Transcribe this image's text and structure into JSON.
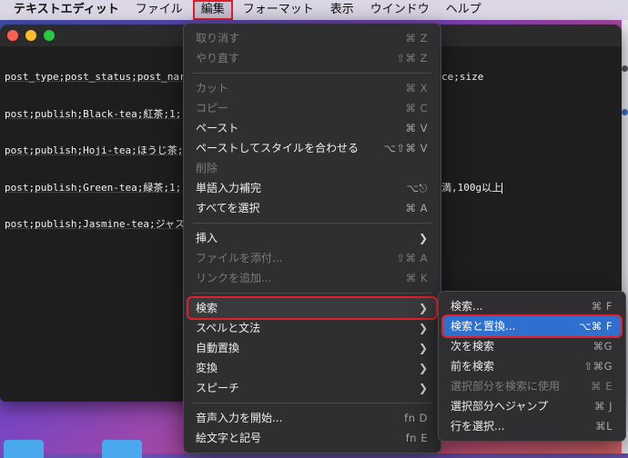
{
  "menubar": {
    "app": "テキストエディット",
    "items": [
      "ファイル",
      "編集",
      "フォーマット",
      "表示",
      "ウインドウ",
      "ヘルプ"
    ]
  },
  "document": {
    "lines": [
      "post_type;post_status;post_nar",
      "post;publish;Black-tea;紅茶;1;",
      "post;publish;Hoji-tea;ほうじ茶;",
      "post;publish;Green-tea;緑茶;1;",
      "post;publish;Jasmine-tea;ジャス"
    ],
    "right_lines": [
      "ce;size",
      "",
      "",
      "満,100g以上"
    ]
  },
  "edit_menu": {
    "items": [
      {
        "label": "取り消す",
        "shortcut": "⌘ Z",
        "disabled": true
      },
      {
        "label": "やり直す",
        "shortcut": "⇧⌘ Z",
        "disabled": true
      },
      {
        "sep": true
      },
      {
        "label": "カット",
        "shortcut": "⌘ X",
        "disabled": true
      },
      {
        "label": "コピー",
        "shortcut": "⌘ C",
        "disabled": true
      },
      {
        "label": "ペースト",
        "shortcut": "⌘ V"
      },
      {
        "label": "ペーストしてスタイルを合わせる",
        "shortcut": "⌥⇧⌘ V"
      },
      {
        "label": "削除",
        "shortcut": "",
        "disabled": true
      },
      {
        "label": "単語入力補完",
        "shortcut": "⌥⎋"
      },
      {
        "label": "すべてを選択",
        "shortcut": "⌘ A"
      },
      {
        "sep": true
      },
      {
        "label": "挿入",
        "submenu": true
      },
      {
        "label": "ファイルを添付...",
        "shortcut": "⇧⌘ A",
        "disabled": true
      },
      {
        "label": "リンクを追加...",
        "shortcut": "⌘ K",
        "disabled": true
      },
      {
        "sep": true
      },
      {
        "label": "検索",
        "submenu": true,
        "highlight": true
      },
      {
        "label": "スペルと文法",
        "submenu": true
      },
      {
        "label": "自動置換",
        "submenu": true
      },
      {
        "label": "変換",
        "submenu": true
      },
      {
        "label": "スピーチ",
        "submenu": true
      },
      {
        "sep": true
      },
      {
        "label": "音声入力を開始...",
        "shortcut": "fn D"
      },
      {
        "label": "絵文字と記号",
        "shortcut": "fn E"
      }
    ]
  },
  "find_menu": {
    "items": [
      {
        "label": "検索...",
        "shortcut": "⌘ F"
      },
      {
        "label": "検索と置換...",
        "shortcut": "⌥⌘ F",
        "selected": true
      },
      {
        "label": "次を検索",
        "shortcut": "⌘G"
      },
      {
        "label": "前を検索",
        "shortcut": "⇧⌘G"
      },
      {
        "label": "選択部分を検索に使用",
        "shortcut": "⌘ E",
        "disabled": true
      },
      {
        "label": "選択部分へジャンプ",
        "shortcut": "⌘ J"
      },
      {
        "label": "行を選択...",
        "shortcut": "⌘L"
      }
    ]
  }
}
